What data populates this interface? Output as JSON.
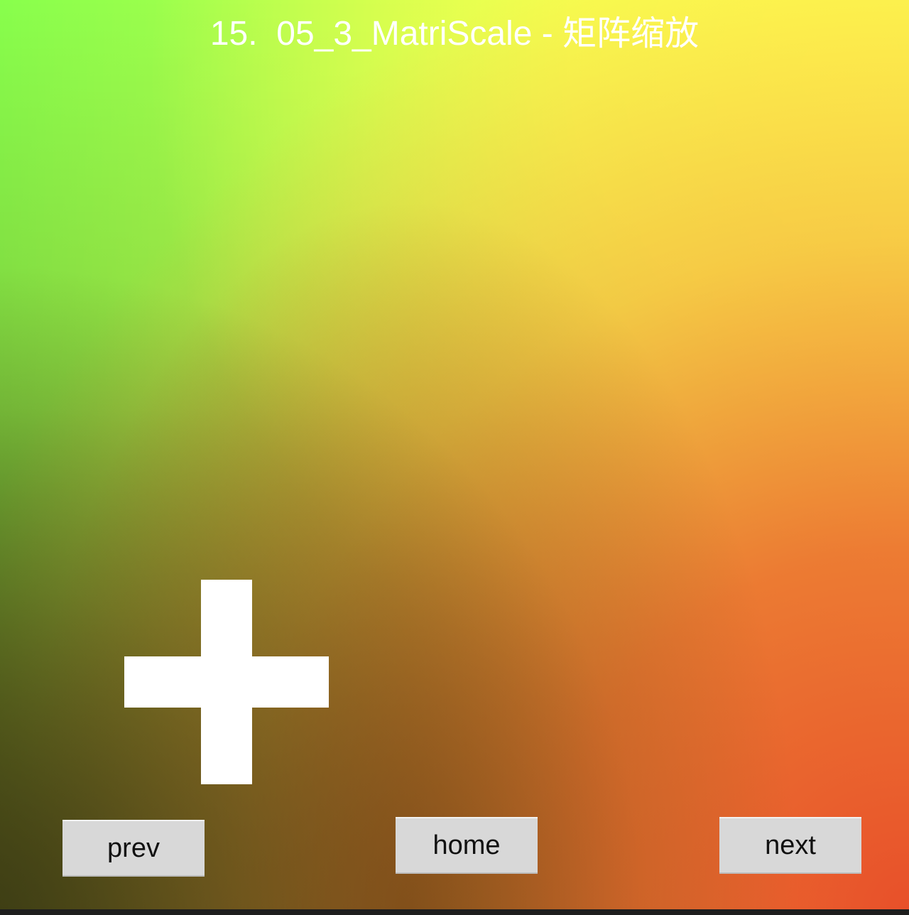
{
  "title": "15.  05_3_MatriScale - 矩阵缩放",
  "buttons": {
    "prev": "prev",
    "home": "home",
    "next": "next"
  },
  "colors": {
    "background_top_left": "#88ff4c",
    "background_top_right": "#ffff50",
    "background_bottom_left": "#3f4a12",
    "background_bottom_right": "#e8502a",
    "shape": "#ffffff",
    "button_bg": "#d8d8d8",
    "button_text": "#111111",
    "title_text": "#ffffff"
  },
  "shape": {
    "type": "plus-icon"
  }
}
